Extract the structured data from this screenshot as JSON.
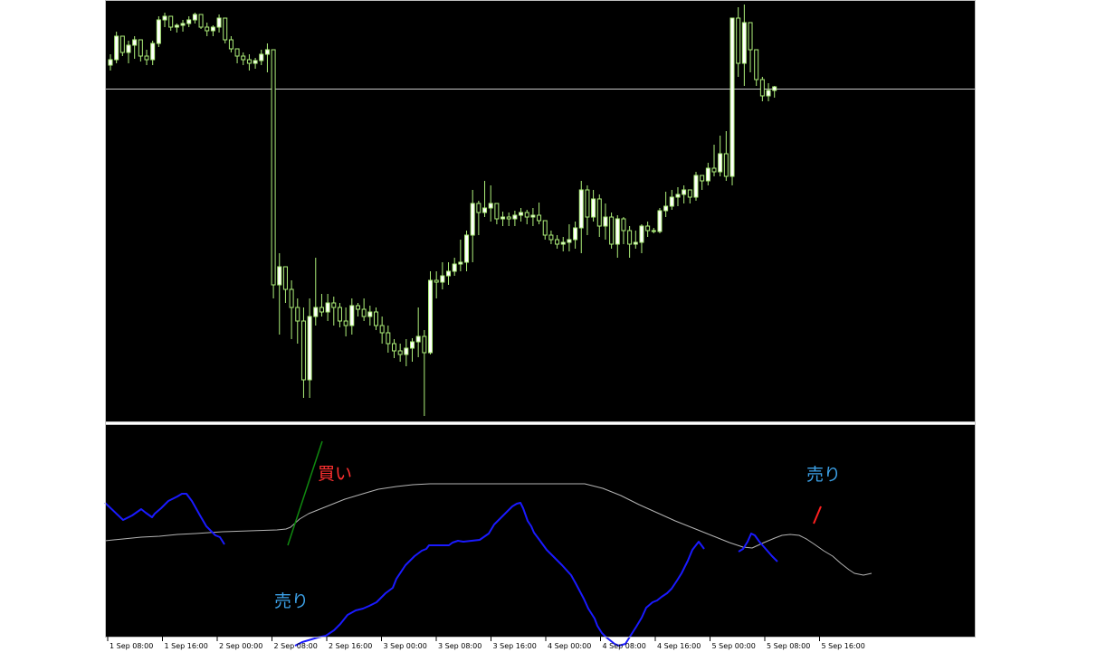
{
  "colors": {
    "background": "#000000",
    "frame": "#c0c0c0",
    "candle": "#aef07a",
    "fast_line": "#1a1aff",
    "slow_line": "#b4b4b4",
    "buy_text": "#ff3030",
    "sell_text": "#3ca0e6",
    "buy_stroke": "#108a10",
    "sell_stroke": "#ff2020",
    "price_level": "#c8c8c8"
  },
  "chart_data": [
    {
      "type": "candlestick",
      "title": "",
      "grid": false,
      "ylim": [
        0,
        460
      ],
      "price_level": 98,
      "candles": [
        [
          72,
          60,
          78,
          66
        ],
        [
          66,
          35,
          70,
          40
        ],
        [
          40,
          42,
          62,
          58
        ],
        [
          58,
          45,
          70,
          50
        ],
        [
          50,
          40,
          65,
          44
        ],
        [
          44,
          48,
          68,
          62
        ],
        [
          62,
          55,
          72,
          66
        ],
        [
          66,
          45,
          72,
          48
        ],
        [
          48,
          18,
          52,
          22
        ],
        [
          22,
          14,
          30,
          18
        ],
        [
          18,
          24,
          34,
          30
        ],
        [
          30,
          26,
          36,
          28
        ],
        [
          28,
          22,
          35,
          26
        ],
        [
          26,
          18,
          30,
          22
        ],
        [
          22,
          14,
          26,
          16
        ],
        [
          16,
          18,
          32,
          30
        ],
        [
          30,
          25,
          40,
          34
        ],
        [
          34,
          28,
          40,
          30
        ],
        [
          30,
          16,
          36,
          20
        ],
        [
          20,
          30,
          48,
          44
        ],
        [
          44,
          40,
          58,
          54
        ],
        [
          54,
          55,
          70,
          62
        ],
        [
          62,
          58,
          72,
          66
        ],
        [
          66,
          60,
          78,
          70
        ],
        [
          70,
          64,
          76,
          67
        ],
        [
          67,
          55,
          72,
          60
        ],
        [
          60,
          48,
          80,
          55
        ],
        [
          55,
          310,
          330,
          315
        ],
        [
          315,
          280,
          370,
          295
        ],
        [
          295,
          300,
          335,
          320
        ],
        [
          320,
          310,
          375,
          340
        ],
        [
          340,
          330,
          380,
          355
        ],
        [
          355,
          340,
          440,
          420
        ],
        [
          420,
          330,
          440,
          350
        ],
        [
          350,
          285,
          360,
          340
        ],
        [
          340,
          325,
          350,
          345
        ],
        [
          345,
          325,
          355,
          335
        ],
        [
          335,
          328,
          360,
          340
        ],
        [
          340,
          335,
          362,
          355
        ],
        [
          355,
          340,
          372,
          360
        ],
        [
          360,
          330,
          370,
          338
        ],
        [
          338,
          335,
          350,
          342
        ],
        [
          342,
          330,
          355,
          350
        ],
        [
          350,
          338,
          360,
          345
        ],
        [
          345,
          340,
          365,
          360
        ],
        [
          360,
          350,
          380,
          368
        ],
        [
          368,
          360,
          390,
          380
        ],
        [
          380,
          375,
          396,
          388
        ],
        [
          388,
          380,
          400,
          392
        ],
        [
          392,
          375,
          405,
          385
        ],
        [
          385,
          374,
          400,
          378
        ],
        [
          378,
          340,
          395,
          372
        ],
        [
          372,
          365,
          460,
          390
        ],
        [
          390,
          300,
          392,
          310
        ],
        [
          310,
          300,
          330,
          312
        ],
        [
          312,
          290,
          320,
          305
        ],
        [
          305,
          290,
          315,
          300
        ],
        [
          300,
          285,
          305,
          292
        ],
        [
          292,
          265,
          300,
          290
        ],
        [
          290,
          255,
          300,
          260
        ],
        [
          260,
          210,
          290,
          225
        ],
        [
          225,
          222,
          260,
          235
        ],
        [
          235,
          200,
          240,
          230
        ],
        [
          230,
          205,
          245,
          225
        ],
        [
          225,
          235,
          248,
          242
        ],
        [
          242,
          234,
          250,
          240
        ],
        [
          240,
          235,
          250,
          242
        ],
        [
          242,
          233,
          250,
          238
        ],
        [
          238,
          230,
          245,
          235
        ],
        [
          235,
          232,
          248,
          240
        ],
        [
          240,
          230,
          250,
          238
        ],
        [
          238,
          224,
          248,
          244
        ],
        [
          244,
          245,
          265,
          260
        ],
        [
          260,
          255,
          270,
          265
        ],
        [
          265,
          260,
          275,
          270
        ],
        [
          270,
          262,
          278,
          268
        ],
        [
          268,
          248,
          278,
          265
        ],
        [
          265,
          245,
          275,
          252
        ],
        [
          252,
          200,
          280,
          210
        ],
        [
          210,
          205,
          260,
          240
        ],
        [
          240,
          210,
          245,
          220
        ],
        [
          220,
          215,
          262,
          250
        ],
        [
          250,
          225,
          265,
          240
        ],
        [
          240,
          235,
          275,
          270
        ],
        [
          270,
          238,
          285,
          242
        ],
        [
          242,
          240,
          270,
          255
        ],
        [
          255,
          250,
          285,
          270
        ],
        [
          270,
          255,
          275,
          268
        ],
        [
          268,
          248,
          280,
          250
        ],
        [
          250,
          245,
          262,
          255
        ],
        [
          255,
          252,
          258,
          256
        ],
        [
          256,
          230,
          258,
          233
        ],
        [
          233,
          212,
          240,
          228
        ],
        [
          228,
          210,
          232,
          218
        ],
        [
          218,
          207,
          228,
          215
        ],
        [
          215,
          205,
          225,
          210
        ],
        [
          210,
          212,
          225,
          218
        ],
        [
          218,
          190,
          222,
          194
        ],
        [
          194,
          200,
          210,
          200
        ],
        [
          200,
          180,
          205,
          186
        ],
        [
          186,
          160,
          195,
          190
        ],
        [
          190,
          150,
          195,
          170
        ],
        [
          170,
          145,
          200,
          195
        ],
        [
          195,
          75,
          205,
          20
        ],
        [
          20,
          8,
          85,
          70
        ],
        [
          70,
          5,
          95,
          25
        ],
        [
          25,
          30,
          80,
          55
        ],
        [
          55,
          60,
          95,
          88
        ],
        [
          88,
          85,
          112,
          106
        ],
        [
          106,
          92,
          112,
          100
        ],
        [
          100,
          95,
          108,
          96
        ]
      ]
    },
    {
      "type": "line",
      "title": "",
      "grid": false,
      "ylim": [
        0,
        240
      ],
      "series": [
        {
          "values": [
            [
              0,
              86
            ],
            [
              20,
              105
            ],
            [
              30,
              100
            ],
            [
              40,
              93
            ],
            [
              45,
              97
            ],
            [
              52,
              102
            ],
            [
              55,
              98
            ],
            [
              62,
              92
            ],
            [
              70,
              84
            ],
            [
              76,
              81
            ],
            [
              80,
              79
            ],
            [
              85,
              76
            ],
            [
              90,
              76
            ],
            [
              96,
              84
            ],
            [
              105,
              100
            ],
            [
              112,
              112
            ],
            [
              117,
              117
            ],
            [
              122,
              122
            ],
            [
              127,
              124
            ],
            [
              132,
              132
            ]
          ]
        },
        {
          "values": [
            [
              210,
              244
            ],
            [
              218,
              240
            ],
            [
              235,
              235
            ],
            [
              244,
              233
            ],
            [
              253,
              227
            ],
            [
              260,
              220
            ],
            [
              268,
              210
            ],
            [
              277,
              205
            ],
            [
              285,
              203
            ],
            [
              292,
              200
            ],
            [
              300,
              196
            ],
            [
              310,
              186
            ],
            [
              318,
              180
            ],
            [
              322,
              170
            ],
            [
              332,
              155
            ],
            [
              342,
              145
            ],
            [
              350,
              139
            ],
            [
              355,
              137
            ],
            [
              358,
              133
            ],
            [
              380,
              133
            ],
            [
              384,
              130
            ],
            [
              390,
              128
            ],
            [
              396,
              129
            ],
            [
              414,
              127
            ],
            [
              424,
              120
            ],
            [
              430,
              110
            ],
            [
              440,
              100
            ],
            [
              447,
              93
            ],
            [
              450,
              90
            ],
            [
              455,
              87
            ],
            [
              459,
              86
            ],
            [
              462,
              92
            ],
            [
              467,
              106
            ],
            [
              471,
              112
            ],
            [
              474,
              119
            ],
            [
              480,
              127
            ],
            [
              488,
              138
            ],
            [
              496,
              146
            ],
            [
              505,
              155
            ],
            [
              515,
              166
            ],
            [
              520,
              175
            ],
            [
              529,
              192
            ],
            [
              534,
              203
            ],
            [
              541,
              214
            ],
            [
              544,
              222
            ],
            [
              549,
              230
            ],
            [
              553,
              234
            ],
            [
              558,
              238
            ],
            [
              563,
              242
            ],
            [
              568,
              244
            ],
            [
              575,
              242
            ],
            [
              580,
              234
            ],
            [
              587,
              223
            ],
            [
              593,
              213
            ],
            [
              598,
              202
            ],
            [
              605,
              196
            ],
            [
              610,
              194
            ],
            [
              615,
              190
            ],
            [
              621,
              186
            ],
            [
              626,
              181
            ],
            [
              632,
              172
            ],
            [
              637,
              164
            ],
            [
              644,
              150
            ],
            [
              649,
              138
            ],
            [
              656,
              129
            ],
            [
              662,
              137
            ]
          ]
        },
        {
          "values": [
            [
              700,
              140
            ],
            [
              705,
              137
            ],
            [
              710,
              129
            ],
            [
              714,
              120
            ],
            [
              718,
              122
            ],
            [
              723,
              129
            ],
            [
              730,
              137
            ],
            [
              737,
              145
            ],
            [
              743,
              151
            ]
          ]
        },
        {
          "values": [
            [
              0,
              128
            ],
            [
              20,
              126
            ],
            [
              40,
              124
            ],
            [
              60,
              123
            ],
            [
              80,
              121
            ],
            [
              100,
              120
            ],
            [
              130,
              118
            ],
            [
              160,
              117
            ],
            [
              190,
              116
            ],
            [
              200,
              115
            ],
            [
              205,
              113
            ],
            [
              215,
              104
            ],
            [
              225,
              98
            ],
            [
              245,
              90
            ],
            [
              265,
              82
            ],
            [
              285,
              76
            ],
            [
              302,
              71
            ],
            [
              322,
              68
            ],
            [
              340,
              66
            ],
            [
              359,
              65
            ],
            [
              404,
              65
            ],
            [
              484,
              65
            ],
            [
              530,
              65
            ],
            [
              550,
              70
            ],
            [
              570,
              78
            ],
            [
              590,
              88
            ],
            [
              610,
              97
            ],
            [
              630,
              106
            ],
            [
              650,
              114
            ],
            [
              670,
              122
            ],
            [
              690,
              130
            ],
            [
              705,
              135
            ],
            [
              715,
              136
            ],
            [
              728,
              130
            ],
            [
              740,
              125
            ],
            [
              748,
              122
            ],
            [
              757,
              121
            ],
            [
              767,
              122
            ],
            [
              775,
              126
            ],
            [
              784,
              132
            ],
            [
              794,
              139
            ],
            [
              804,
              145
            ],
            [
              813,
              153
            ],
            [
              822,
              160
            ],
            [
              828,
              164
            ],
            [
              838,
              166
            ],
            [
              847,
              164
            ]
          ]
        }
      ],
      "annotations": [
        {
          "text": "買い",
          "value": 42
        },
        {
          "text": "売り",
          "value": 163
        },
        {
          "text": "売り",
          "value": 40
        }
      ]
    }
  ],
  "x_axis": {
    "labels": [
      "1 Sep 08:00",
      "1 Sep 16:00",
      "2 Sep 00:00",
      "2 Sep 08:00",
      "2 Sep 16:00",
      "3 Sep 00:00",
      "3 Sep 08:00",
      "3 Sep 16:00",
      "4 Sep 00:00",
      "4 Sep 08:00",
      "4 Sep 16:00",
      "5 Sep 00:00",
      "5 Sep 08:00",
      "5 Sep 16:00"
    ]
  }
}
